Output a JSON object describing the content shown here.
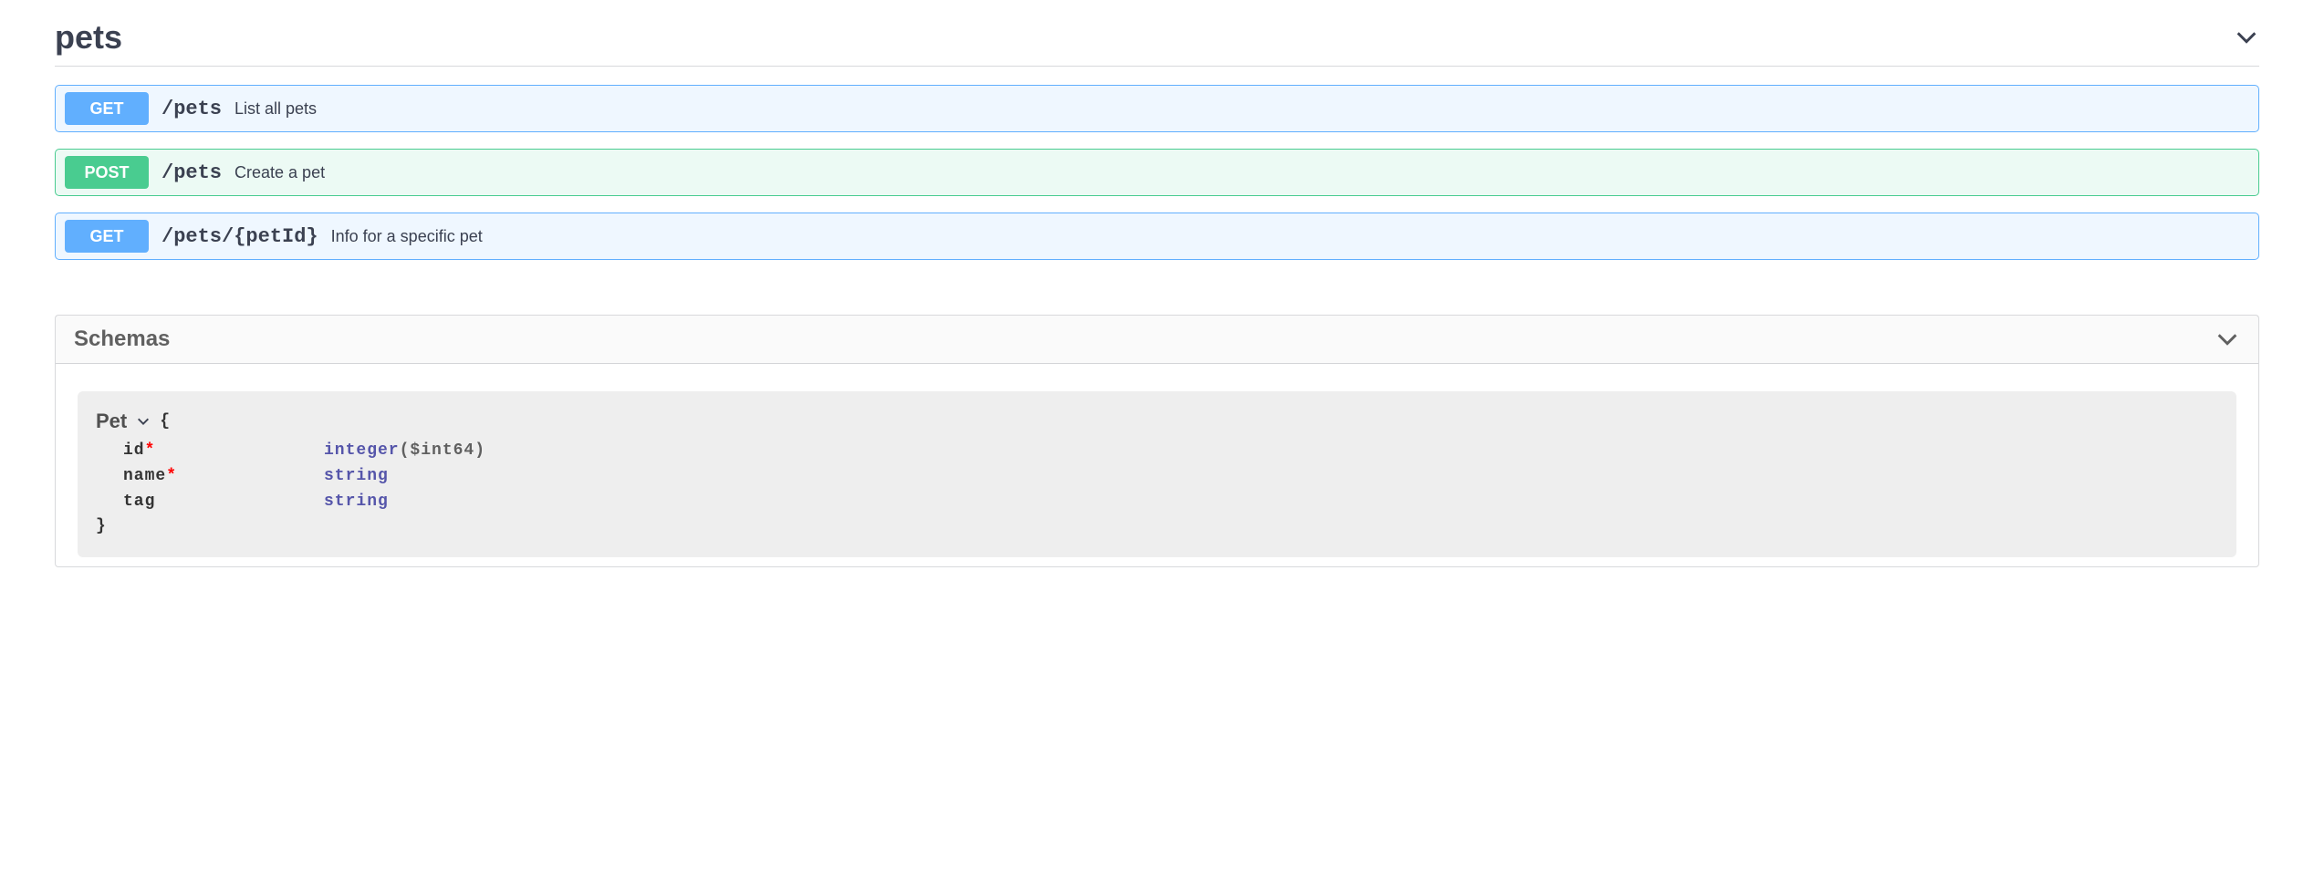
{
  "tag": {
    "name": "pets"
  },
  "operations": [
    {
      "method": "GET",
      "method_class": "get",
      "path": "/pets",
      "summary": "List all pets"
    },
    {
      "method": "POST",
      "method_class": "post",
      "path": "/pets",
      "summary": "Create a pet"
    },
    {
      "method": "GET",
      "method_class": "get",
      "path": "/pets/{petId}",
      "summary": "Info for a specific pet"
    }
  ],
  "schemas": {
    "title": "Schemas",
    "models": [
      {
        "name": "Pet",
        "open_brace": "{",
        "close_brace": "}",
        "properties": [
          {
            "name": "id",
            "required": true,
            "type": "integer",
            "format": "($int64)"
          },
          {
            "name": "name",
            "required": true,
            "type": "string",
            "format": ""
          },
          {
            "name": "tag",
            "required": false,
            "type": "string",
            "format": ""
          }
        ]
      }
    ]
  }
}
